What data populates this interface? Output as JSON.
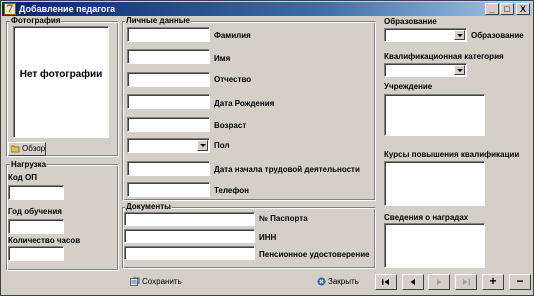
{
  "window": {
    "title": "Добавление педагога",
    "app_icon_glyph": "7",
    "minimize_glyph": "_",
    "maximize_glyph": "□",
    "close_glyph": "X"
  },
  "photo": {
    "group_caption": "Фотография",
    "placeholder": "Нет фотографии",
    "browse_label": "Обзор",
    "browse_icon": "folder-icon"
  },
  "personal": {
    "group_caption": "Личные данные",
    "last_name": {
      "label": "Фамилия",
      "value": ""
    },
    "first_name": {
      "label": "Имя",
      "value": ""
    },
    "middle_name": {
      "label": "Отчество",
      "value": ""
    },
    "birth_date": {
      "label": "Дата Рождения",
      "value": ""
    },
    "age": {
      "label": "Возраст",
      "value": ""
    },
    "gender": {
      "label": "Пол",
      "value": ""
    },
    "work_start": {
      "label": "Дата начала трудовой деятельности",
      "value": ""
    },
    "phone": {
      "label": "Телефон",
      "value": ""
    }
  },
  "workload": {
    "group_caption": "Нагрузка",
    "op_code": {
      "label": "Код ОП",
      "value": ""
    },
    "study_year": {
      "label": "Год обучения",
      "value": ""
    },
    "hours": {
      "label": "Количество часов",
      "value": ""
    }
  },
  "documents": {
    "group_caption": "Документы",
    "passport": {
      "label": "№ Паспорта",
      "value": ""
    },
    "inn": {
      "label": "ИНН",
      "value": ""
    },
    "pension": {
      "label": "Пенсионное удостоверение",
      "value": ""
    }
  },
  "education": {
    "group_caption": "Образование",
    "education_select": {
      "label": "Образование",
      "value": ""
    },
    "category": {
      "label": "Квалификационная категория",
      "value": ""
    },
    "institution": {
      "label": "Учреждение",
      "value": ""
    },
    "courses": {
      "label": "Курсы повышения квалификации",
      "value": ""
    },
    "awards": {
      "label": "Сведения о наградах",
      "value": ""
    }
  },
  "actions": {
    "save_label": "Сохранить",
    "save_icon": "save-icon",
    "close_label": "Закрыть",
    "close_icon": "close-circle-icon"
  },
  "navigator": {
    "buttons": [
      "first-record-icon",
      "prior-record-icon",
      "next-record-icon",
      "last-record-icon",
      "add-record-icon",
      "delete-record-icon"
    ],
    "plus_glyph": "+",
    "minus_glyph": "−"
  }
}
